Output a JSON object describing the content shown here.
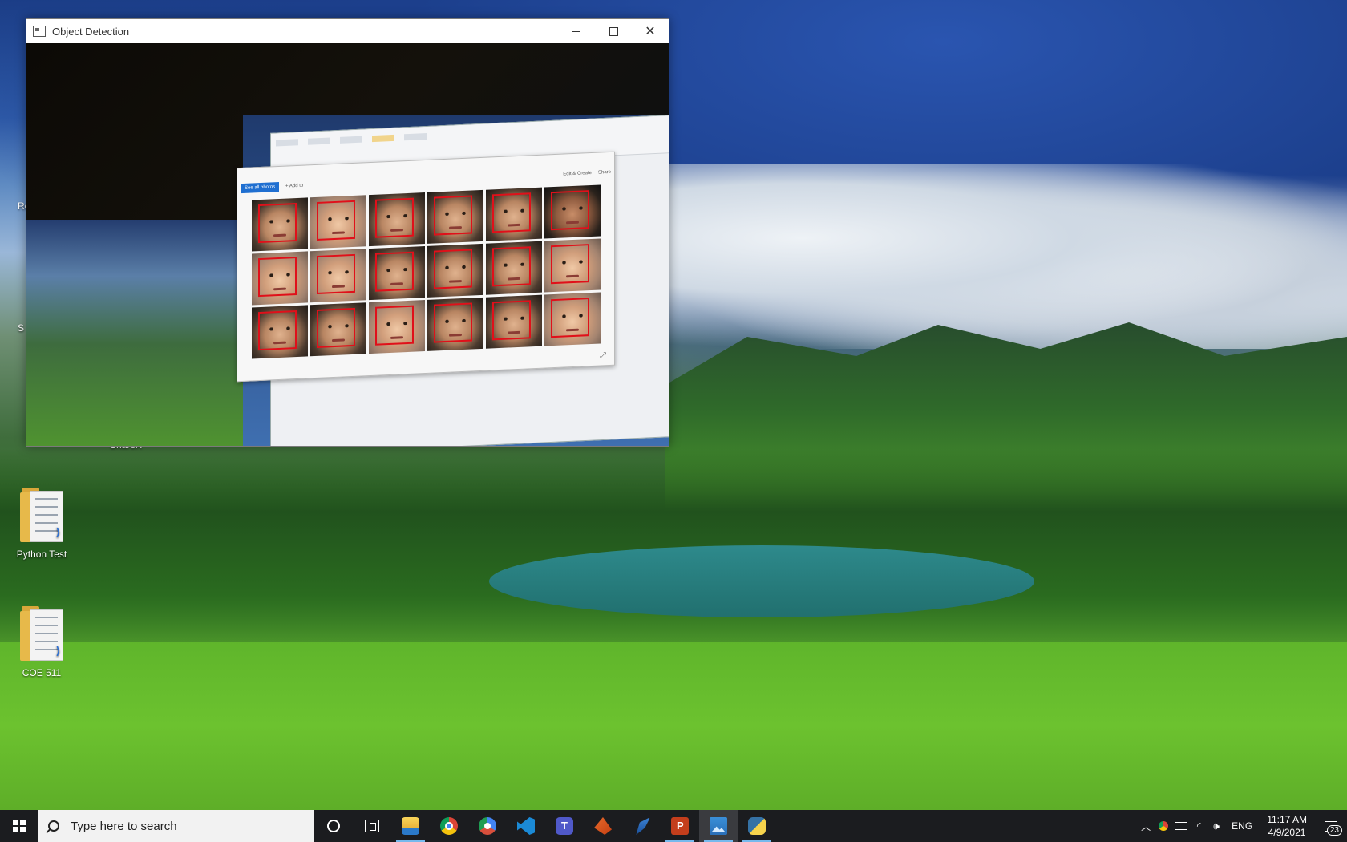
{
  "window": {
    "title": "Object Detection",
    "minimize": "minimize",
    "maximize": "maximize",
    "close": "✕"
  },
  "camera_feed": {
    "photos_app": {
      "see_all_photos": "See all photos",
      "add_to": "+ Add to",
      "edit_create": "Edit & Create",
      "share": "Share",
      "faces_rows": 3,
      "faces_cols": 6,
      "detection_box_color": "#e0101a"
    }
  },
  "desktop_icons": [
    {
      "label": "ShareX"
    },
    {
      "label": "Python Test"
    },
    {
      "label": "COE 511"
    }
  ],
  "partial_desktop_labels": [
    "Re",
    "S"
  ],
  "taskbar": {
    "search_placeholder": "Type here to search",
    "pinned": [
      {
        "name": "cortana",
        "icon": "circle-icon"
      },
      {
        "name": "task-view",
        "icon": "task-view-icon"
      },
      {
        "name": "file-explorer",
        "icon": "folder-icon"
      },
      {
        "name": "chrome",
        "icon": "chrome-icon"
      },
      {
        "name": "chrome-canary",
        "icon": "chrome-canary-icon"
      },
      {
        "name": "vscode",
        "icon": "vscode-icon"
      },
      {
        "name": "teams",
        "icon": "teams-icon"
      },
      {
        "name": "matlab",
        "icon": "matlab-icon"
      },
      {
        "name": "wireshark",
        "icon": "wireshark-icon"
      },
      {
        "name": "powerpoint",
        "icon": "powerpoint-icon"
      },
      {
        "name": "photos",
        "icon": "photos-icon",
        "active": true
      },
      {
        "name": "python",
        "icon": "python-icon",
        "running": true
      }
    ],
    "tray": {
      "language": "ENG",
      "time": "11:17 AM",
      "date": "4/9/2021",
      "notification_count": "23"
    }
  },
  "colors": {
    "accent_running": "#76b9ed",
    "taskbar_bg": "#1b1c1f"
  }
}
